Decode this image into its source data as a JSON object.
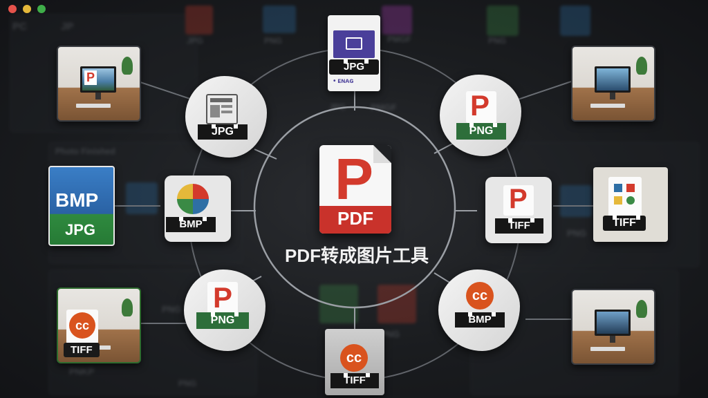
{
  "window_controls": {
    "close_color": "#e5534b",
    "minimize_color": "#e5b83a",
    "maximize_color": "#3fae49"
  },
  "background": {
    "texts": [
      "PC",
      "JP",
      "JPG",
      "PNG",
      "PNG",
      "PMGF",
      "Photo Finished",
      "PNG",
      "PNG",
      "PNG",
      "PMGF",
      "PNKP",
      "PNG",
      "JPG"
    ]
  },
  "center": {
    "file_label": "PDF",
    "title": "PDF转成图片工具",
    "accent": "#d33a2c"
  },
  "nodes": {
    "top": {
      "label": "JPG",
      "sublabel": "• ᴇɴᴀɢ"
    },
    "upper_left": {
      "label": "JPG"
    },
    "upper_right": {
      "label": "PNG"
    },
    "left": {
      "label": "BMP"
    },
    "right": {
      "label": "TIFF"
    },
    "lower_left": {
      "label": "PNG"
    },
    "lower_right": {
      "label": "BMP"
    },
    "bottom": {
      "label": "TIFF"
    }
  },
  "side_cards": {
    "bmp_card": {
      "top_label": "BMP",
      "bottom_label": "JPG"
    },
    "tiff_card_right": {
      "label": "TIFF"
    },
    "tiff_card_left": {
      "label": "TIFF"
    }
  },
  "icons": [
    "pdf-file-icon",
    "jpg-file-icon",
    "png-file-icon",
    "bmp-file-icon",
    "tiff-file-icon",
    "creative-commons-icon"
  ]
}
